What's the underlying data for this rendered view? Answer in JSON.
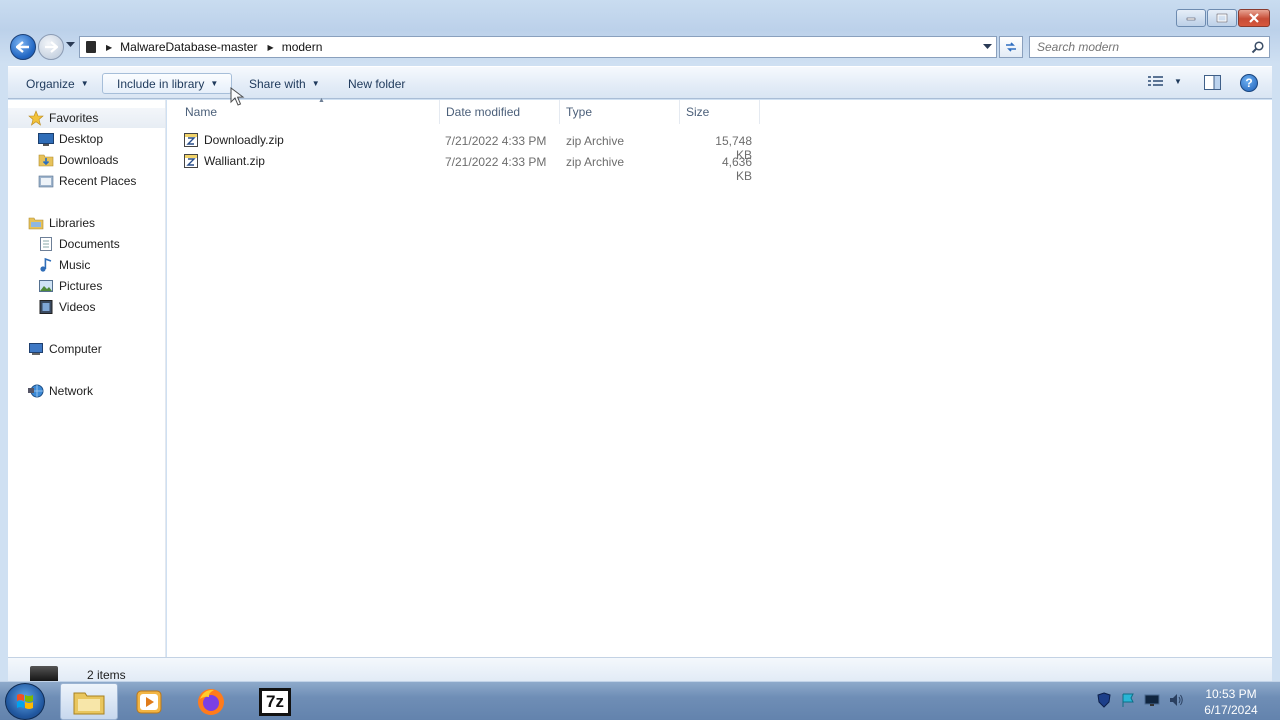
{
  "address": {
    "crumbs": [
      "MalwareDatabase-master",
      "modern"
    ]
  },
  "search": {
    "placeholder": "Search modern"
  },
  "toolbar": {
    "organize": "Organize",
    "include_in_library": "Include in library",
    "share_with": "Share with",
    "new_folder": "New folder"
  },
  "nav": {
    "favorites": "Favorites",
    "desktop": "Desktop",
    "downloads": "Downloads",
    "recent_places": "Recent Places",
    "libraries": "Libraries",
    "documents": "Documents",
    "music": "Music",
    "pictures": "Pictures",
    "videos": "Videos",
    "computer": "Computer",
    "network": "Network"
  },
  "columns": {
    "name": "Name",
    "date_modified": "Date modified",
    "type": "Type",
    "size": "Size"
  },
  "files": [
    {
      "name": "Downloadly.zip",
      "date": "7/21/2022 4:33 PM",
      "type": "zip Archive",
      "size": "15,748 KB"
    },
    {
      "name": "Walliant.zip",
      "date": "7/21/2022 4:33 PM",
      "type": "zip Archive",
      "size": "4,636 KB"
    }
  ],
  "status": {
    "count": "2 items"
  },
  "taskbar": {
    "sevenzip_label": "7z",
    "time": "10:53 PM",
    "date": "6/17/2024"
  }
}
